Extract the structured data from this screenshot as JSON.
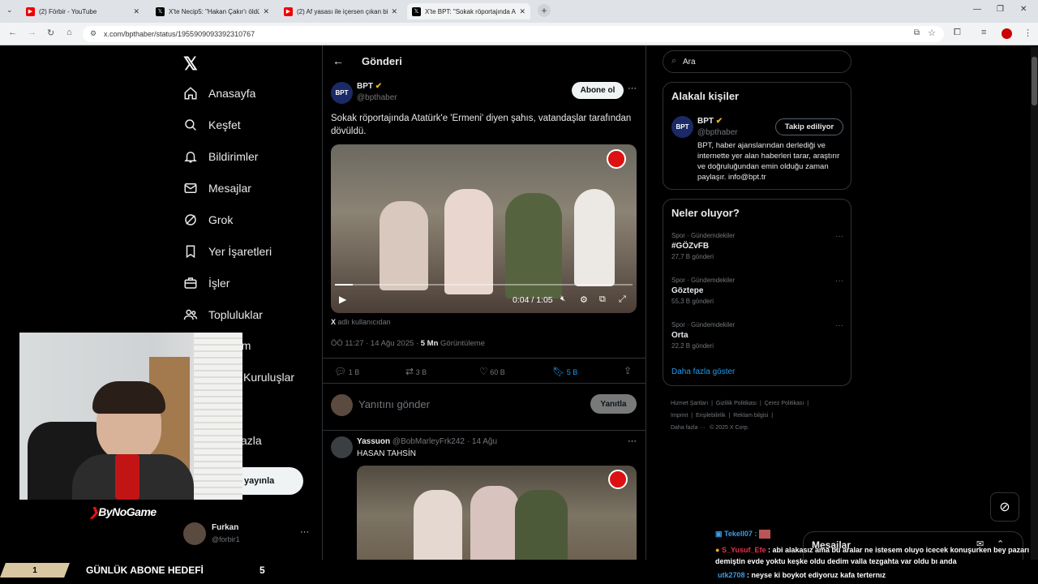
{
  "browser": {
    "tabs": [
      {
        "title": "(2) Förbir - YouTube",
        "icon": "youtube-icon"
      },
      {
        "title": "X'te Necip5: \"Hakan Çakır'ı öldü",
        "icon": "x-icon"
      },
      {
        "title": "(2) Af yasası ile içersen çıkan bi",
        "icon": "youtube-icon"
      },
      {
        "title": "X'te BPT: \"Sokak röportajında A",
        "icon": "x-icon"
      }
    ],
    "url": "x.com/bpthaber/status/1955909093392310767"
  },
  "nav": {
    "items": [
      {
        "label": "Anasayfa",
        "icon": "home-icon"
      },
      {
        "label": "Keşfet",
        "icon": "search-icon"
      },
      {
        "label": "Bildirimler",
        "icon": "bell-icon"
      },
      {
        "label": "Mesajlar",
        "icon": "mail-icon"
      },
      {
        "label": "Grok",
        "icon": "grok-icon"
      },
      {
        "label": "Yer İşaretleri",
        "icon": "bookmark-icon"
      },
      {
        "label": "İşler",
        "icon": "briefcase-icon"
      },
      {
        "label": "Topluluklar",
        "icon": "people-icon"
      }
    ],
    "partial": {
      "premium": "um",
      "orgs": "Kuruluşlar",
      "more": "azla"
    },
    "post_button": "yayınla",
    "user": {
      "name": "Furkan",
      "handle": "@forbir1"
    }
  },
  "post": {
    "header": "Gönderi",
    "author": "BPT",
    "handle": "@bpthaber",
    "follow": "Abone ol",
    "text": "Sokak röportajında Atatürk'e 'Ermeni' diyen şahıs, vatandaşlar tarafından dövüldü.",
    "video_time": "0:04 / 1:05",
    "video_progress": 0.06,
    "source_user": "X",
    "source_text": "adlı kullanıcıdan",
    "timestamp": "ÖÖ 11:27 · 14 Ağu 2025 · ",
    "views": "5 Mn",
    "views_label": "Görüntüleme",
    "replies": "1 B",
    "reposts": "3 B",
    "likes": "60 B",
    "bookmarks": "5 B",
    "reply_placeholder": "Yanıtını gönder",
    "reply_button": "Yanıtla"
  },
  "reply": {
    "author": "Yassuon",
    "meta": "@BobMarleyFrk242 · 14 Ağu",
    "text": "HASAN TAHSİN"
  },
  "right": {
    "search_placeholder": "Ara",
    "related_title": "Alakalı kişiler",
    "related": {
      "name": "BPT",
      "handle": "@bpthaber",
      "button": "Takip ediliyor",
      "bio": "BPT, haber ajanslarından derlediği ve internette yer alan haberleri tarar, araştırır ve doğruluğundan emin olduğu zaman paylaşır. info@bpt.tr"
    },
    "trends_title": "Neler oluyor?",
    "trends": [
      {
        "cat": "Spor · Gündemdekiler",
        "name": "#GÖZvFB",
        "count": "27,7 B gönderi"
      },
      {
        "cat": "Spor · Gündemdekiler",
        "name": "Göztepe",
        "count": "55,3 B gönderi"
      },
      {
        "cat": "Spor · Gündemdekiler",
        "name": "Orta",
        "count": "22,2 B gönderi"
      }
    ],
    "show_more": "Daha fazla göster",
    "footer": {
      "l1": [
        "Hizmet Şartları",
        "Gizlilik Politikası",
        "Çerez Politikası"
      ],
      "l2": [
        "Imprint",
        "Erişilebilirlik",
        "Reklam bilgisi"
      ],
      "l3": "Daha fazla ···",
      "copy": "© 2025 X Corp."
    },
    "messages": "Mesajlar"
  },
  "overlay": {
    "brand": "ByNoGame",
    "goal_number": "1",
    "goal_text": "GÜNLÜK ABONE HEDEFİ",
    "goal_target": "5",
    "chat": [
      {
        "user": "Tekell07 :",
        "text": ""
      },
      {
        "user": "S_Yusuf_Efe",
        "text": ": abi alakasız ama bu aralar ne istesem oluyo icecek konuşurken bey pazarı demiştin evde yoktu keşke oldu dedim valla tezgahta var oldu bı anda"
      },
      {
        "user": "utk2708",
        "text": ": neyse ki boykot ediyoruz kafa terternız"
      }
    ]
  },
  "colors": {
    "accent": "#1d9bf0",
    "verified": "#e2b719",
    "bg": "#000000",
    "border": "#2f3336"
  }
}
